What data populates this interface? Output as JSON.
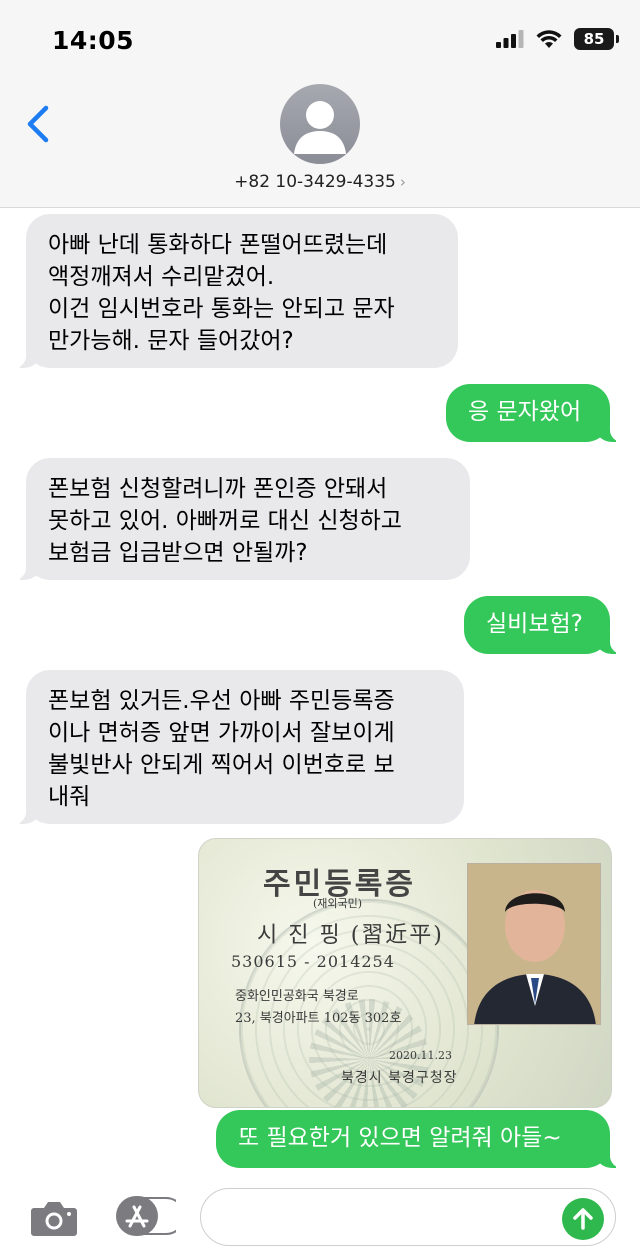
{
  "status_bar": {
    "time": "14:05",
    "battery": "85",
    "icons": [
      "cellular-signal-icon",
      "wifi-icon",
      "battery-icon"
    ]
  },
  "header": {
    "contact": "+82 10-3429-4335",
    "chevron": "›"
  },
  "messages": [
    {
      "side": "incoming",
      "text": "아빠 난데 통화하다 폰떨어뜨렸는데\n액정깨져서 수리맡겼어.\n이건 임시번호라 통화는 안되고 문자\n만가능해. 문자 들어갔어?"
    },
    {
      "side": "outgoing",
      "text": "응 문자왔어"
    },
    {
      "side": "incoming",
      "text": "폰보험 신청할려니까 폰인증 안돼서\n못하고 있어. 아빠꺼로 대신 신청하고\n보험금 입금받으면 안될까?"
    },
    {
      "side": "outgoing",
      "text": "실비보험?"
    },
    {
      "side": "incoming",
      "text": "폰보험 있거든.우선 아빠 주민등록증\n이나 면허증 앞면 가까이서 잘보이게\n불빛반사 안되게 찍어서 이번호로 보\n내줘"
    },
    {
      "side": "outgoing",
      "text": "또 필요한거 있으면 알려줘 아들~"
    }
  ],
  "id_card": {
    "title": "주민등록증",
    "subtitle": "(재외국민)",
    "name": "시 진 핑 (習近平)",
    "number": "530615 - 2014254",
    "address_line1": "중화인민공화국 북경로",
    "address_line2": "23, 북경아파트 102동 302호",
    "date": "2020.11.23",
    "issuer": "북경시 북경구청장"
  },
  "input_bar": {
    "placeholder": "",
    "value": ""
  },
  "colors": {
    "incoming_bubble": "#e9e9eb",
    "outgoing_bubble": "#34c759",
    "accent_blue": "#1e7cf2"
  }
}
